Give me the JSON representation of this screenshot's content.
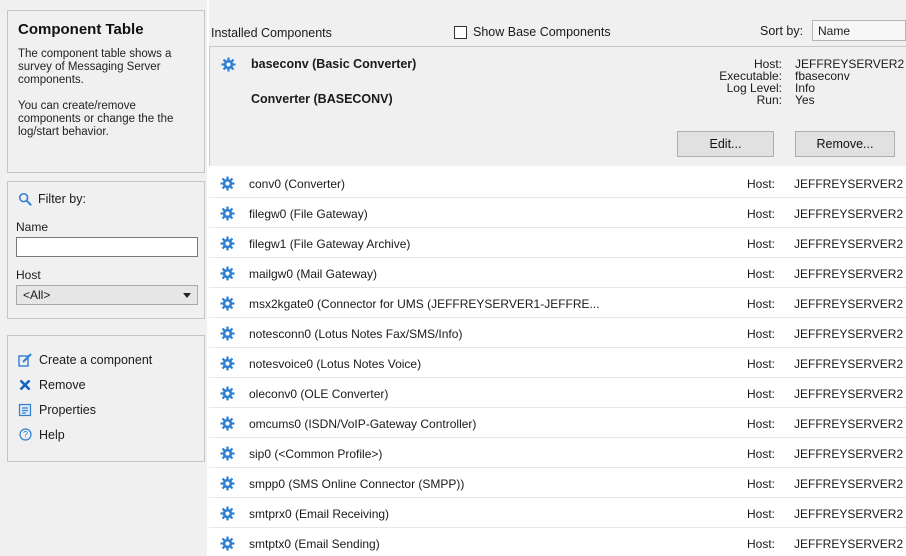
{
  "sidebar": {
    "title": "Component Table",
    "desc1": "The component table shows a survey of Messaging Server components.",
    "desc2": "You can create/remove components or change the the log/start behavior.",
    "filter_label": "Filter by:",
    "name_label": "Name",
    "name_value": "",
    "host_label": "Host",
    "host_value": "<All>",
    "actions": [
      {
        "label": "Create a component",
        "icon": "create-icon"
      },
      {
        "label": "Remove",
        "icon": "remove-x-icon"
      },
      {
        "label": "Properties",
        "icon": "properties-icon"
      },
      {
        "label": "Help",
        "icon": "help-icon"
      }
    ]
  },
  "toolbar": {
    "title": "Installed Components",
    "show_base_label": "Show Base Components",
    "show_base_checked": false,
    "sort_label": "Sort by:",
    "sort_value": "Name"
  },
  "selected": {
    "name": "baseconv  (Basic Converter)",
    "type": "Converter (BASECONV)",
    "host_key": "Host:",
    "host": "JEFFREYSERVER2",
    "exe_key": "Executable:",
    "executable": "fbaseconv",
    "log_key": "Log Level:",
    "log_level": "Info",
    "run_key": "Run:",
    "run": "Yes",
    "edit_label": "Edit...",
    "remove_label": "Remove..."
  },
  "components": [
    {
      "name": "conv0  (Converter)",
      "host_key": "Host:",
      "host": "JEFFREYSERVER2"
    },
    {
      "name": "filegw0  (File Gateway)",
      "host_key": "Host:",
      "host": "JEFFREYSERVER2"
    },
    {
      "name": "filegw1  (File Gateway Archive)",
      "host_key": "Host:",
      "host": "JEFFREYSERVER2"
    },
    {
      "name": "mailgw0  (Mail Gateway)",
      "host_key": "Host:",
      "host": "JEFFREYSERVER2"
    },
    {
      "name": "msx2kgate0  (Connector for UMS (JEFFREYSERVER1-JEFFRE...",
      "host_key": "Host:",
      "host": "JEFFREYSERVER2"
    },
    {
      "name": "notesconn0  (Lotus Notes Fax/SMS/Info)",
      "host_key": "Host:",
      "host": "JEFFREYSERVER2"
    },
    {
      "name": "notesvoice0  (Lotus Notes Voice)",
      "host_key": "Host:",
      "host": "JEFFREYSERVER2"
    },
    {
      "name": "oleconv0  (OLE Converter)",
      "host_key": "Host:",
      "host": "JEFFREYSERVER2"
    },
    {
      "name": "omcums0  (ISDN/VoIP-Gateway Controller)",
      "host_key": "Host:",
      "host": "JEFFREYSERVER2"
    },
    {
      "name": "sip0  (<Common Profile>)",
      "host_key": "Host:",
      "host": "JEFFREYSERVER2"
    },
    {
      "name": "smpp0  (SMS Online Connector (SMPP))",
      "host_key": "Host:",
      "host": "JEFFREYSERVER2"
    },
    {
      "name": "smtprx0  (Email Receiving)",
      "host_key": "Host:",
      "host": "JEFFREYSERVER2"
    },
    {
      "name": "smtptx0  (Email Sending)",
      "host_key": "Host:",
      "host": "JEFFREYSERVER2"
    }
  ],
  "colors": {
    "gear": "#2f7fd3",
    "remove_x": "#1565c0",
    "panel_bg": "#f0f0f0"
  }
}
